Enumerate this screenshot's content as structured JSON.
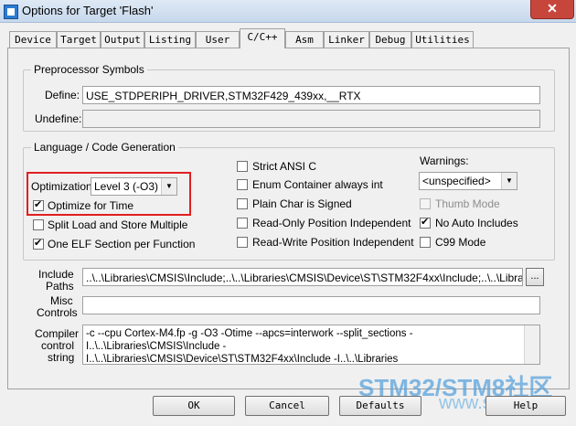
{
  "window": {
    "title": "Options for Target 'Flash'",
    "close_glyph": "✕"
  },
  "tabs": [
    {
      "label": "Device"
    },
    {
      "label": "Target"
    },
    {
      "label": "Output"
    },
    {
      "label": "Listing"
    },
    {
      "label": "User"
    },
    {
      "label": "C/C++",
      "active": true
    },
    {
      "label": "Asm"
    },
    {
      "label": "Linker"
    },
    {
      "label": "Debug"
    },
    {
      "label": "Utilities"
    }
  ],
  "preprocessor": {
    "group_label": "Preprocessor Symbols",
    "define_label": "Define:",
    "define_value": "USE_STDPERIPH_DRIVER,STM32F429_439xx,__RTX",
    "undefine_label": "Undefine:",
    "undefine_value": ""
  },
  "language": {
    "group_label": "Language / Code Generation",
    "optimization_label": "Optimization:",
    "optimization_value": "Level 3 (-O3)",
    "optimize_for_time": "Optimize for Time",
    "split_load_store": "Split Load and Store Multiple",
    "one_elf_section": "One ELF Section per Function",
    "strict_ansi_c": "Strict ANSI C",
    "enum_container": "Enum Container always int",
    "plain_char_signed": "Plain Char is Signed",
    "ro_position_independent": "Read-Only Position Independent",
    "rw_position_independent": "Read-Write Position Independent",
    "warnings_label": "Warnings:",
    "warnings_value": "<unspecified>",
    "thumb_mode": "Thumb Mode",
    "no_auto_includes": "No Auto Includes",
    "c99_mode": "C99 Mode"
  },
  "paths": {
    "include_label_1": "Include",
    "include_label_2": "Paths",
    "include_value": "..\\..\\Libraries\\CMSIS\\Include;..\\..\\Libraries\\CMSIS\\Device\\ST\\STM32F4xx\\Include;..\\..\\Libraries\\S",
    "browse_label": "...",
    "misc_label_1": "Misc",
    "misc_label_2": "Controls",
    "misc_value": "",
    "compiler_label_1": "Compiler",
    "compiler_label_2": "control",
    "compiler_label_3": "string",
    "compiler_line_1": "-c --cpu Cortex-M4.fp -g -O3 -Otime --apcs=interwork --split_sections -I..\\..\\Libraries\\CMSIS\\Include -",
    "compiler_line_2": "I..\\..\\Libraries\\CMSIS\\Device\\ST\\STM32F4xx\\Include -I..\\..\\Libraries"
  },
  "buttons": {
    "ok": "OK",
    "cancel": "Cancel",
    "defaults": "Defaults",
    "help": "Help"
  },
  "watermark": {
    "line1": "STM32/STM8社区",
    "line2": "www.stmcu.org"
  },
  "colors": {
    "highlight": "#e02020",
    "accent": "#2b7cd3"
  }
}
